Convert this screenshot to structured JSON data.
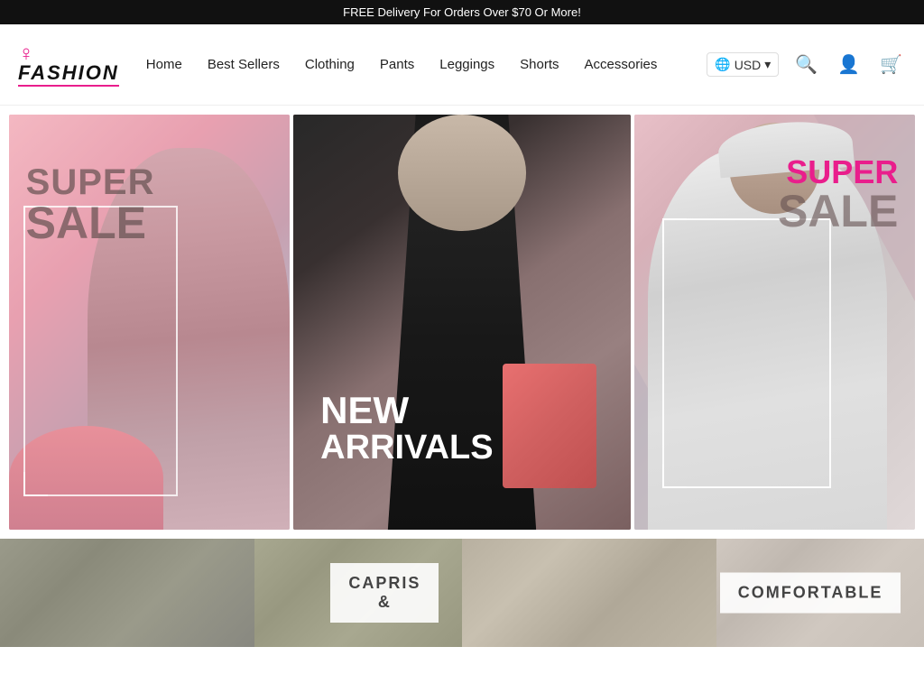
{
  "banner": {
    "text": "FREE Delivery For Orders Over $70 Or More!"
  },
  "header": {
    "logo": {
      "text": "FASHION",
      "aria": "Fashion Store Logo"
    },
    "nav": {
      "items": [
        {
          "label": "Home",
          "id": "home"
        },
        {
          "label": "Best Sellers",
          "id": "best-sellers"
        },
        {
          "label": "Clothing",
          "id": "clothing"
        },
        {
          "label": "Pants",
          "id": "pants"
        },
        {
          "label": "Leggings",
          "id": "leggings"
        },
        {
          "label": "Shorts",
          "id": "shorts"
        },
        {
          "label": "Accessories",
          "id": "accessories"
        }
      ]
    },
    "currency": {
      "symbol": "🌐",
      "value": "USD",
      "arrow": "▾"
    }
  },
  "hero": {
    "panels": [
      {
        "id": "panel-left",
        "line1": "SUPER",
        "line2": "SALE",
        "theme": "pink"
      },
      {
        "id": "panel-center",
        "line1": "NEW",
        "line2": "ARRIVALS",
        "theme": "dark"
      },
      {
        "id": "panel-right",
        "line1": "SUPER",
        "line2": "SALE",
        "theme": "light-pink"
      }
    ]
  },
  "bottom": {
    "panels": [
      {
        "id": "capris",
        "label1": "CAPRIS",
        "label2": "&"
      },
      {
        "id": "comfortable",
        "label1": "COMFORTABLE",
        "label2": ""
      }
    ]
  },
  "icons": {
    "search": "🔍",
    "user": "👤",
    "cart": "🛒",
    "globe": "🌐"
  }
}
